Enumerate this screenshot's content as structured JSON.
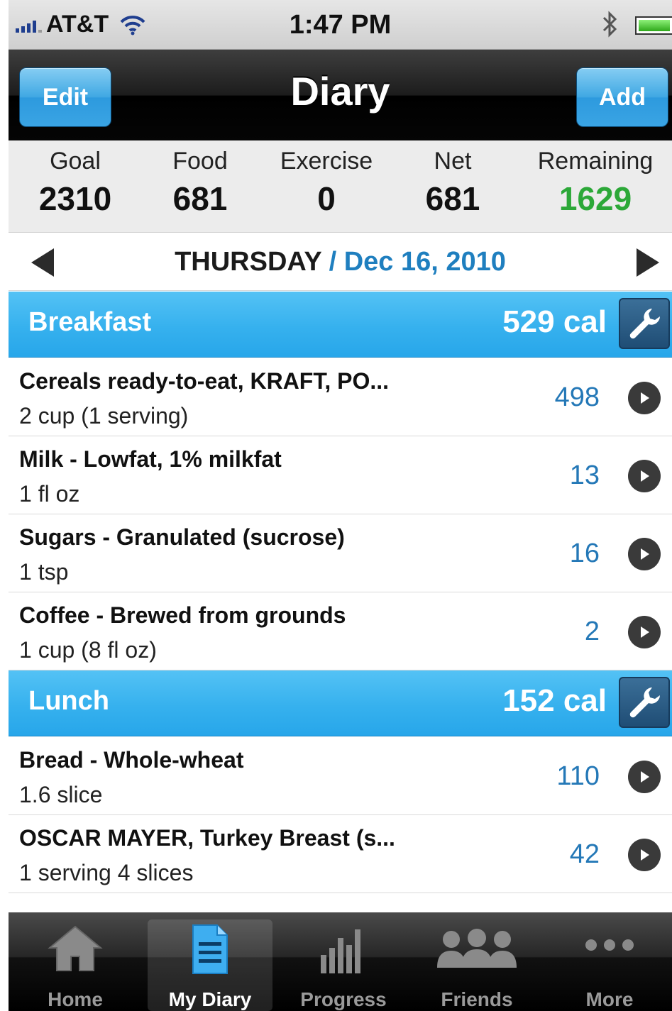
{
  "status_bar": {
    "carrier": "AT&T",
    "time": "1:47 PM",
    "icons": [
      "signal-icon",
      "wifi-icon",
      "bluetooth-icon",
      "battery-icon"
    ]
  },
  "nav_bar": {
    "title": "Diary",
    "left_button": "Edit",
    "right_button": "Add"
  },
  "summary": {
    "goal_label": "Goal",
    "goal_value": "2310",
    "food_label": "Food",
    "food_value": "681",
    "exercise_label": "Exercise",
    "exercise_value": "0",
    "net_label": "Net",
    "net_value": "681",
    "remaining_label": "Remaining",
    "remaining_value": "1629",
    "remaining_color": "#2ca838"
  },
  "date_nav": {
    "day": "THURSDAY",
    "separator": "/",
    "date": "Dec 16, 2010"
  },
  "meals": [
    {
      "name": "Breakfast",
      "calories": "529 cal",
      "items": [
        {
          "name": "Cereals ready-to-eat, KRAFT, PO...",
          "serving": "2 cup (1 serving)",
          "calories": "498"
        },
        {
          "name": "Milk - Lowfat, 1% milkfat",
          "serving": "1 fl oz",
          "calories": "13"
        },
        {
          "name": "Sugars - Granulated (sucrose)",
          "serving": "1 tsp",
          "calories": "16"
        },
        {
          "name": "Coffee - Brewed from grounds",
          "serving": "1 cup (8 fl oz)",
          "calories": "2"
        }
      ]
    },
    {
      "name": "Lunch",
      "calories": "152 cal",
      "items": [
        {
          "name": "Bread - Whole-wheat",
          "serving": "1.6 slice",
          "calories": "110"
        },
        {
          "name": "OSCAR MAYER, Turkey Breast (s...",
          "serving": "1 serving 4 slices",
          "calories": "42"
        }
      ]
    }
  ],
  "tab_bar": {
    "tabs": [
      {
        "label": "Home",
        "icon": "home-icon"
      },
      {
        "label": "My Diary",
        "icon": "diary-icon",
        "active": true
      },
      {
        "label": "Progress",
        "icon": "progress-icon"
      },
      {
        "label": "Friends",
        "icon": "friends-icon"
      },
      {
        "label": "More",
        "icon": "more-icon"
      }
    ]
  },
  "colors": {
    "accent_blue": "#36b1ee",
    "calorie_blue": "#2478b7",
    "remaining_green": "#2ca838"
  }
}
